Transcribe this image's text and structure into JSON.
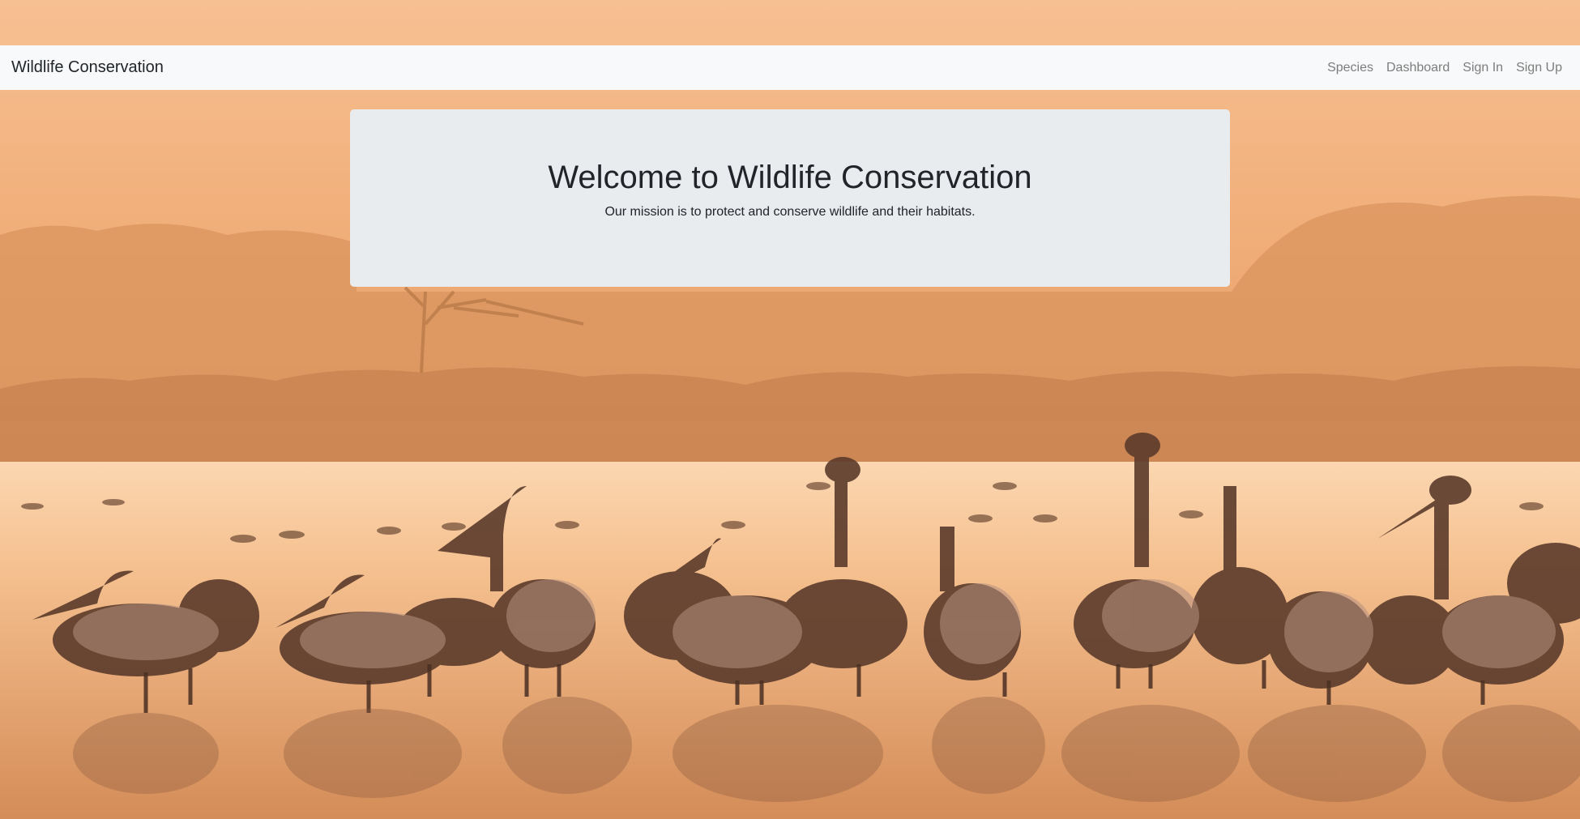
{
  "navbar": {
    "brand": "Wildlife Conservation",
    "links": [
      "Species",
      "Dashboard",
      "Sign In",
      "Sign Up"
    ]
  },
  "hero": {
    "title": "Welcome to Wildlife Conservation",
    "subtitle": "Our mission is to protect and conserve wildlife and their habitats."
  },
  "background": {
    "description_icon": "pelicans-sunset-photo"
  }
}
